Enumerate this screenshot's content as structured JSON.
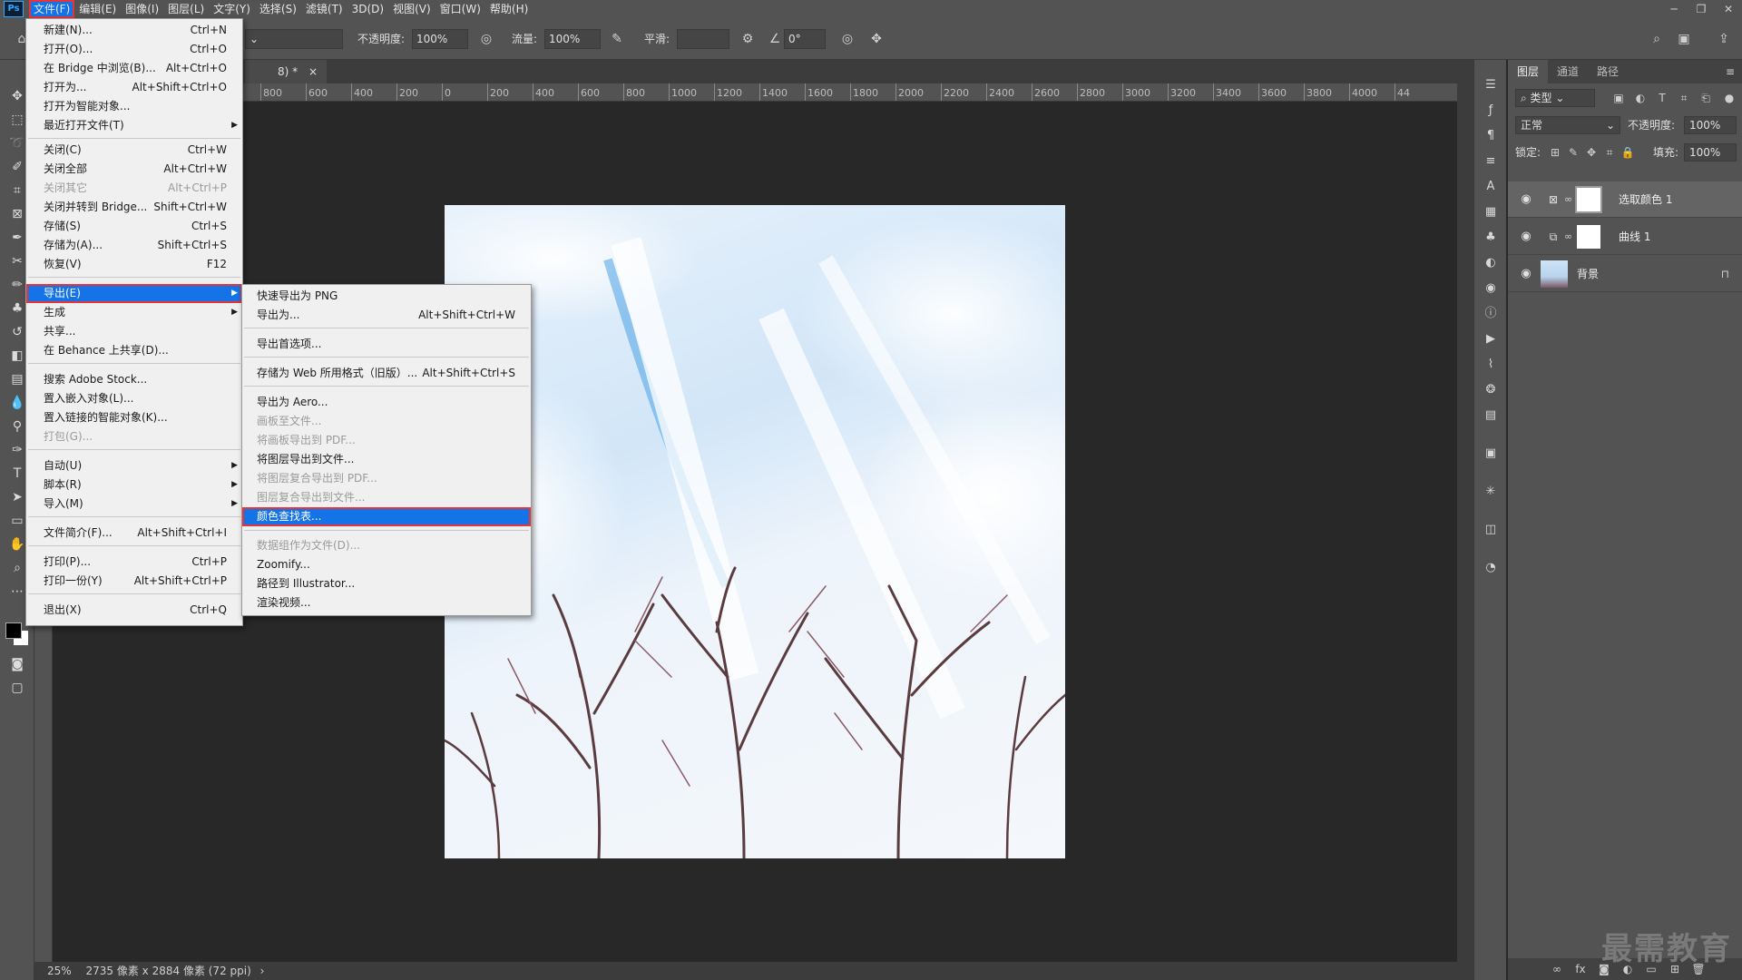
{
  "menubar": {
    "items": [
      "文件(F)",
      "编辑(E)",
      "图像(I)",
      "图层(L)",
      "文字(Y)",
      "选择(S)",
      "滤镜(T)",
      "3D(D)",
      "视图(V)",
      "窗口(W)",
      "帮助(H)"
    ],
    "logo": "Ps",
    "window_controls": [
      "─",
      "❐",
      "✕"
    ]
  },
  "options": {
    "opacity_label": "不透明度:",
    "opacity_value": "100%",
    "flow_label": "流量:",
    "flow_value": "100%",
    "smooth_label": "平滑:",
    "angle_value": "0°"
  },
  "document": {
    "tab_title": "8) *",
    "tab_close": "×",
    "ruler_ticks": [
      "800",
      "600",
      "400",
      "200",
      "0",
      "200",
      "400",
      "600",
      "800",
      "1000",
      "1200",
      "1400",
      "1600",
      "1800",
      "2000",
      "2200",
      "2400",
      "2600",
      "2800",
      "3000",
      "3200",
      "3400",
      "3600",
      "3800",
      "4000",
      "44"
    ]
  },
  "status": {
    "zoom": "25%",
    "info": "2735 像素 x 2884 像素 (72 ppi)",
    "arrow": "›"
  },
  "file_menu": {
    "items": [
      {
        "label": "新建(N)...",
        "shortcut": "Ctrl+N"
      },
      {
        "label": "打开(O)...",
        "shortcut": "Ctrl+O"
      },
      {
        "label": "在 Bridge 中浏览(B)...",
        "shortcut": "Alt+Ctrl+O"
      },
      {
        "label": "打开为...",
        "shortcut": "Alt+Shift+Ctrl+O"
      },
      {
        "label": "打开为智能对象...",
        "shortcut": ""
      },
      {
        "label": "最近打开文件(T)",
        "shortcut": ""
      },
      {
        "label": "关闭(C)",
        "shortcut": "Ctrl+W"
      },
      {
        "label": "关闭全部",
        "shortcut": "Alt+Ctrl+W"
      },
      {
        "label": "关闭其它",
        "shortcut": "Alt+Ctrl+P"
      },
      {
        "label": "关闭并转到 Bridge...",
        "shortcut": "Shift+Ctrl+W"
      },
      {
        "label": "存储(S)",
        "shortcut": "Ctrl+S"
      },
      {
        "label": "存储为(A)...",
        "shortcut": "Shift+Ctrl+S"
      },
      {
        "label": "恢复(V)",
        "shortcut": "F12"
      },
      {
        "label": "导出(E)",
        "shortcut": ""
      },
      {
        "label": "生成",
        "shortcut": ""
      },
      {
        "label": "共享...",
        "shortcut": ""
      },
      {
        "label": "在 Behance 上共享(D)...",
        "shortcut": ""
      },
      {
        "label": "搜索 Adobe Stock...",
        "shortcut": ""
      },
      {
        "label": "置入嵌入对象(L)...",
        "shortcut": ""
      },
      {
        "label": "置入链接的智能对象(K)...",
        "shortcut": ""
      },
      {
        "label": "打包(G)...",
        "shortcut": ""
      },
      {
        "label": "自动(U)",
        "shortcut": ""
      },
      {
        "label": "脚本(R)",
        "shortcut": ""
      },
      {
        "label": "导入(M)",
        "shortcut": ""
      },
      {
        "label": "文件简介(F)...",
        "shortcut": "Alt+Shift+Ctrl+I"
      },
      {
        "label": "打印(P)...",
        "shortcut": "Ctrl+P"
      },
      {
        "label": "打印一份(Y)",
        "shortcut": "Alt+Shift+Ctrl+P"
      },
      {
        "label": "退出(X)",
        "shortcut": "Ctrl+Q"
      }
    ]
  },
  "export_menu": {
    "items": [
      {
        "label": "快速导出为 PNG",
        "shortcut": ""
      },
      {
        "label": "导出为...",
        "shortcut": "Alt+Shift+Ctrl+W"
      },
      {
        "label": "导出首选项...",
        "shortcut": ""
      },
      {
        "label": "存储为 Web 所用格式（旧版）...",
        "shortcut": "Alt+Shift+Ctrl+S"
      },
      {
        "label": "导出为 Aero...",
        "shortcut": ""
      },
      {
        "label": "画板至文件...",
        "shortcut": ""
      },
      {
        "label": "将画板导出到 PDF...",
        "shortcut": ""
      },
      {
        "label": "将图层导出到文件...",
        "shortcut": ""
      },
      {
        "label": "将图层复合导出到 PDF...",
        "shortcut": ""
      },
      {
        "label": "图层复合导出到文件...",
        "shortcut": ""
      },
      {
        "label": "颜色查找表...",
        "shortcut": ""
      },
      {
        "label": "数据组作为文件(D)...",
        "shortcut": ""
      },
      {
        "label": "Zoomify...",
        "shortcut": ""
      },
      {
        "label": "路径到 Illustrator...",
        "shortcut": ""
      },
      {
        "label": "渲染视频...",
        "shortcut": ""
      }
    ]
  },
  "layers_panel": {
    "tabs": [
      "图层",
      "通道",
      "路径"
    ],
    "filter_value": "类型",
    "blend_mode": "正常",
    "opacity_label": "不透明度:",
    "opacity_value": "100%",
    "lock_label": "锁定:",
    "fill_label": "填充:",
    "fill_value": "100%",
    "layers": [
      {
        "name": "选取颜色 1"
      },
      {
        "name": "曲线 1"
      },
      {
        "name": "背景"
      }
    ]
  },
  "watermark": "最需教育",
  "colors": {
    "accent": "#1473e6",
    "highlight_border": "#e4353a",
    "panel": "#535353"
  }
}
